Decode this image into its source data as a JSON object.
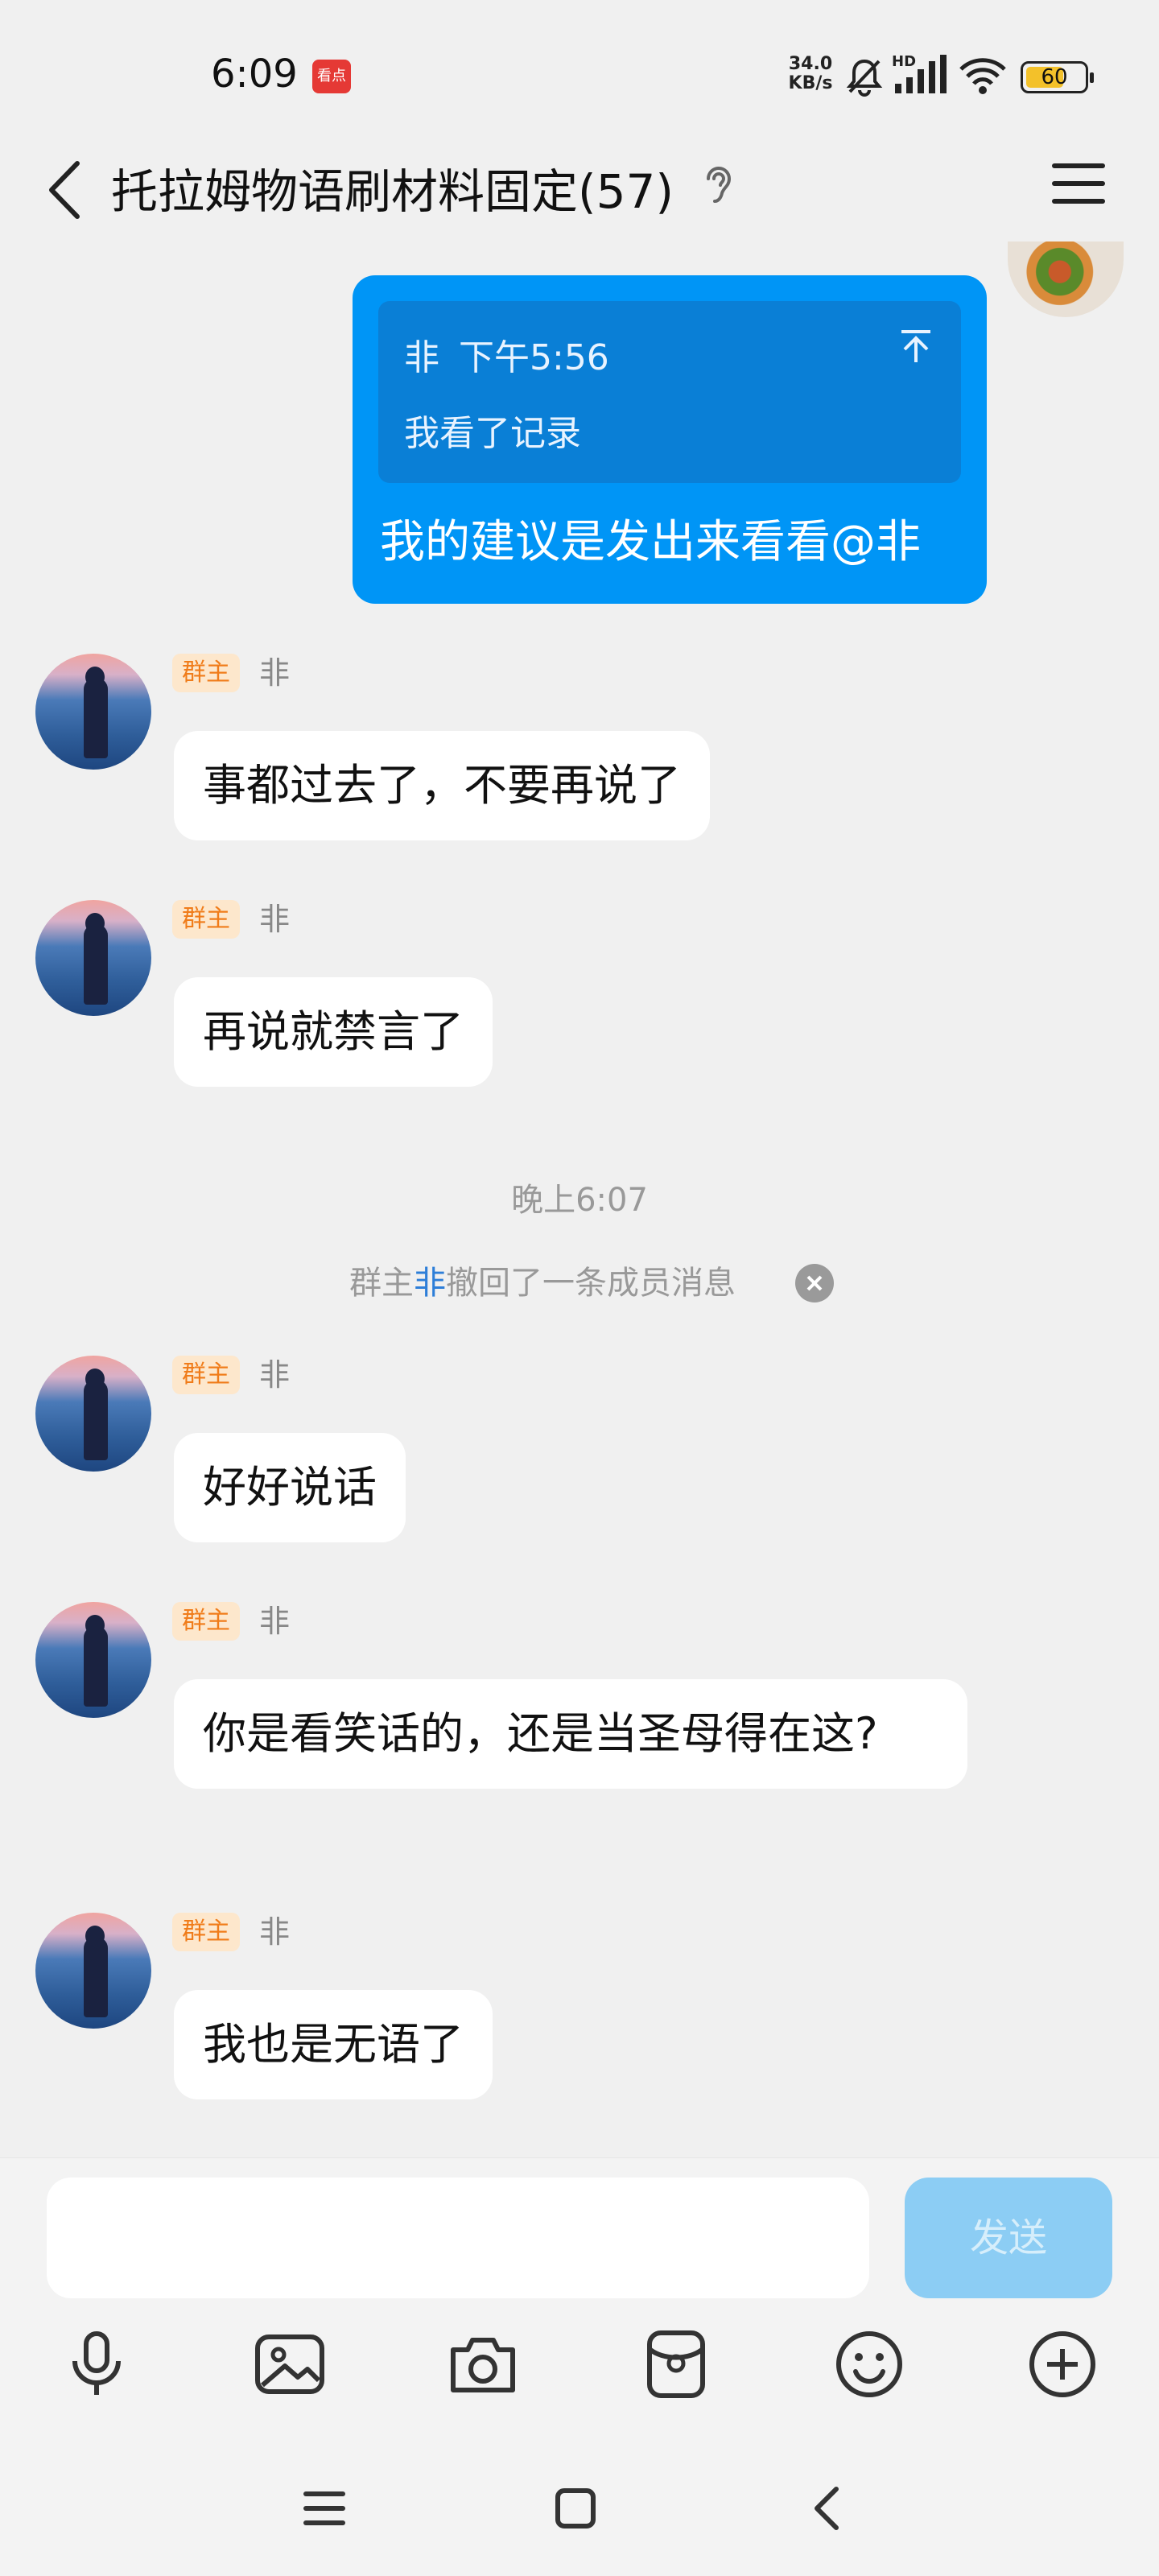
{
  "status_bar": {
    "time": "6:09",
    "app_badge_text": "看点",
    "net_speed_value": "34.0",
    "net_speed_unit": "KB/s",
    "network_label": "HD",
    "battery_level": "60",
    "icons": [
      "app-notification-icon",
      "mute-bell-icon",
      "signal-icon",
      "wifi-icon",
      "battery-icon"
    ]
  },
  "header": {
    "title": "托拉姆物语刷材料固定(57)",
    "icons": [
      "back-icon",
      "ear-icon",
      "menu-icon"
    ]
  },
  "messages": {
    "outgoing": {
      "quote_sender": "非",
      "quote_time": "下午5:56",
      "quote_text": "我看了记录",
      "text": "我的建议是发出来看看@非"
    },
    "incoming": [
      {
        "badge": "群主",
        "sender": "非",
        "text": "事都过去了，不要再说了"
      },
      {
        "badge": "群主",
        "sender": "非",
        "text": "再说就禁言了"
      },
      {
        "badge": "群主",
        "sender": "非",
        "text": "好好说话"
      },
      {
        "badge": "群主",
        "sender": "非",
        "text": "你是看笑话的，还是当圣母得在这?"
      },
      {
        "badge": "群主",
        "sender": "非",
        "text": "我也是无语了"
      }
    ],
    "timestamp": "晚上6:07",
    "recall": {
      "prefix": "群主",
      "name": "非",
      "suffix": "撤回了一条成员消息"
    }
  },
  "input": {
    "value": "",
    "send_label": "发送",
    "tools": [
      "mic-icon",
      "image-icon",
      "camera-icon",
      "red-packet-icon",
      "emoji-icon",
      "plus-icon"
    ]
  },
  "nav": {
    "icons": [
      "recent-apps-icon",
      "home-icon",
      "back-nav-icon"
    ]
  },
  "colors": {
    "accent_blue": "#0095f6",
    "badge_bg": "#fde7cc",
    "badge_text": "#f07c1a",
    "send_disabled": "#8ccdf4",
    "page_bg": "#f0f0f0"
  }
}
